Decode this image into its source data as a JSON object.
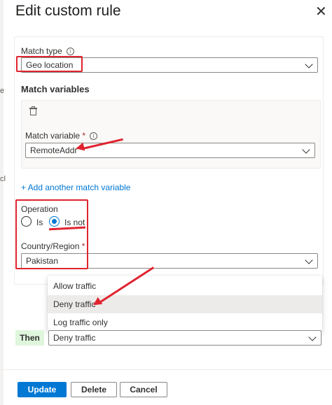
{
  "panel": {
    "title": "Edit custom rule",
    "close_glyph": "✕"
  },
  "background_fragments": [
    "e",
    "cl"
  ],
  "condition": {
    "match_type": {
      "label": "Match type",
      "value": "Geo location"
    },
    "match_variables_title": "Match variables",
    "match_variable": {
      "label": "Match variable",
      "required_mark": "*",
      "value": "RemoteAddr"
    },
    "add_link": "+ Add another match variable",
    "operation": {
      "label": "Operation",
      "options": [
        "Is",
        "Is not"
      ],
      "selected": "Is not"
    },
    "country": {
      "label": "Country/Region",
      "required_mark": "*",
      "value": "Pakistan"
    }
  },
  "action_menu": {
    "items": [
      "Allow traffic",
      "Deny traffic",
      "Log traffic only"
    ],
    "highlighted": "Deny traffic"
  },
  "then": {
    "label": "Then",
    "value": "Deny traffic"
  },
  "footer": {
    "update": "Update",
    "delete": "Delete",
    "cancel": "Cancel"
  },
  "colors": {
    "accent": "#0078d4",
    "annotation": "#e0242f",
    "then_badge": "#dff6dd"
  },
  "icons": [
    "info-icon",
    "trash-icon",
    "chevron-down-icon",
    "close-icon"
  ]
}
